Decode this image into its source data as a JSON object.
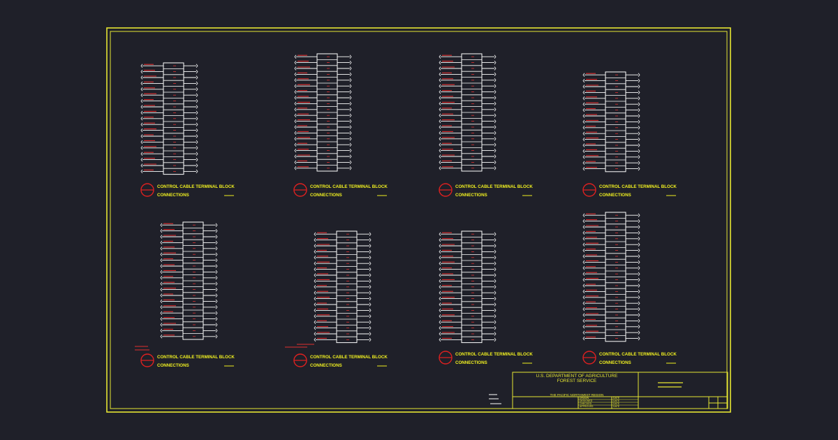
{
  "colors": {
    "background": "#1f2029",
    "border": "#e6e632",
    "block": "#ffffff",
    "wire_label": "#e03030",
    "title": "#f0f020",
    "symbol": "#dd2020"
  },
  "blocks": [
    {
      "id": "b1",
      "title_line1": "CONTROL CABLE TERMINAL BLOCK",
      "title_line2": "CONNECTIONS",
      "terminals": 19,
      "note": "",
      "note2": ""
    },
    {
      "id": "b2",
      "title_line1": "CONTROL CABLE TERMINAL BLOCK",
      "title_line2": "CONNECTIONS",
      "terminals": 20,
      "note": "",
      "note2": ""
    },
    {
      "id": "b3",
      "title_line1": "CONTROL CABLE TERMINAL BLOCK",
      "title_line2": "CONNECTIONS",
      "terminals": 20,
      "note": "",
      "note2": ""
    },
    {
      "id": "b4",
      "title_line1": "CONTROL CABLE TERMINAL BLOCK",
      "title_line2": "CONNECTIONS",
      "terminals": 17,
      "note": "",
      "note2": ""
    },
    {
      "id": "b5",
      "title_line1": "CONTROL CABLE TERMINAL BLOCK",
      "title_line2": "CONNECTIONS",
      "terminals": 20,
      "note": "",
      "note2": ""
    },
    {
      "id": "b6",
      "title_line1": "CONTROL CABLE TERMINAL BLOCK",
      "title_line2": "CONNECTIONS",
      "terminals": 19,
      "note": "",
      "note2": ""
    },
    {
      "id": "b7",
      "title_line1": "CONTROL CABLE TERMINAL BLOCK",
      "title_line2": "CONNECTIONS",
      "terminals": 19,
      "note": "",
      "note2": ""
    },
    {
      "id": "b8",
      "title_line1": "CONTROL CABLE TERMINAL BLOCK",
      "title_line2": "CONNECTIONS",
      "terminals": 22,
      "note": "",
      "note2": ""
    }
  ],
  "title_block": {
    "agency_line1": "U.S. DEPARTMENT OF AGRICULTURE",
    "agency_line2": "FOREST SERVICE",
    "region": "THE PACIFIC NORTHWEST REGION",
    "rows": [
      "DRAWN",
      "DESIGNED",
      "CHECKED",
      "APPROVED"
    ],
    "date_label": "DATE"
  }
}
